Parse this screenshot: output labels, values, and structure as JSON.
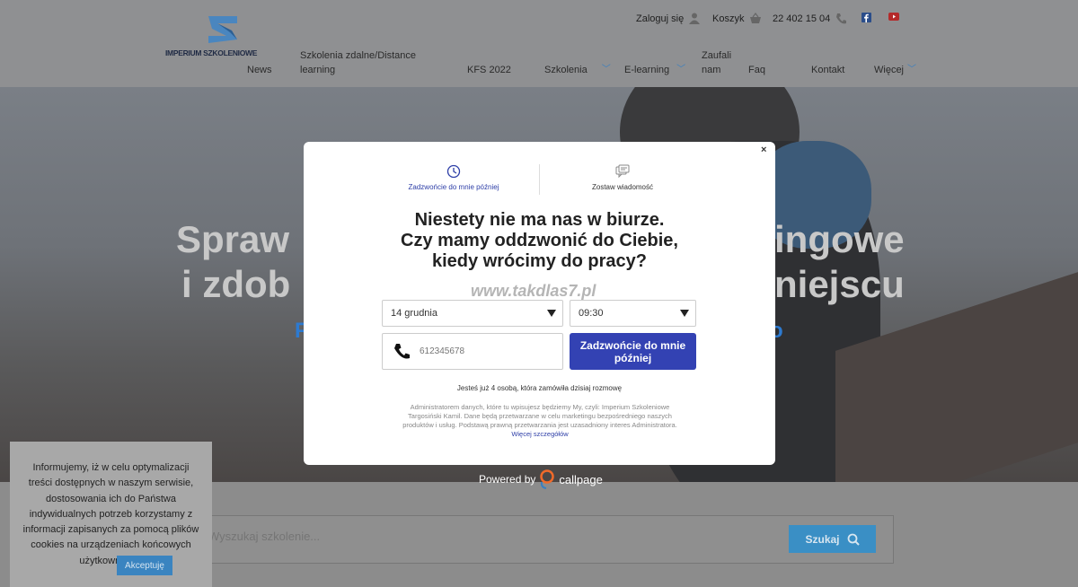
{
  "header": {
    "logo_text": "IMPERIUM SZKOLENIOWE",
    "login_label": "Zaloguj się",
    "cart_label": "Koszyk",
    "phone": "22 402 15 04"
  },
  "nav": {
    "items": [
      {
        "label": "News"
      },
      {
        "label": "Szkolenia zdalne/Distance learning"
      },
      {
        "label": "KFS 2022"
      },
      {
        "label": "Szkolenia"
      },
      {
        "label": "E-learning"
      },
      {
        "label": "Zaufali nam"
      },
      {
        "label": "Faq"
      },
      {
        "label": "Kontakt"
      },
      {
        "label": "Więcej"
      }
    ]
  },
  "hero": {
    "line1_left": "Spraw",
    "line1_right": "ingowe",
    "line2_left": "i zdob",
    "line2_right": "niejscu",
    "blue_left": "F",
    "blue_right": "o"
  },
  "search": {
    "placeholder": "Wyszukaj szkolenie...",
    "button_label": "Szukaj"
  },
  "cookie": {
    "text": "Informujemy, iż w celu optymalizacji treści dostępnych w naszym serwisie, dostosowania ich do Państwa indywidualnych potrzeb korzystamy z informacji zapisanych za pomocą plików cookies na urządzeniach końcowych użytkowników.",
    "accept_label": "Akceptuję"
  },
  "modal": {
    "close_label": "×",
    "tab_call": "Zadzwońcie do mnie później",
    "tab_message": "Zostaw wiadomość",
    "title_line1": "Niestety nie ma nas w biurze.",
    "title_line2": "Czy mamy oddzwonić do Ciebie,",
    "title_line3": "kiedy wrócimy do pracy?",
    "watermark": "www.takdlas7.pl",
    "date_value": "14 grudnia",
    "time_value": "09:30",
    "phone_placeholder": "612345678",
    "call_button": "Zadzwońcie do mnie później",
    "count_prefix": "Jesteś już ",
    "count_number": "4",
    "count_suffix": " osobą, która zamówiła dzisiaj rozmowę",
    "legal_text": "Administratorem danych, które tu wpisujesz będziemy My, czyli: Imperium Szkoleniowe Targosiński Kamil. Dane będą przetwarzane w celu marketingu bezpośredniego naszych produktów i usług. Podstawą prawną przetwarzania jest uzasadniony interes Administratora.",
    "legal_link": "Więcej szczegółów",
    "powered_by": "Powered by",
    "brand": "callpage"
  },
  "colors": {
    "accent": "#3342b3",
    "link_blue": "#2d3ea7",
    "search_button": "#3a8fc5"
  }
}
